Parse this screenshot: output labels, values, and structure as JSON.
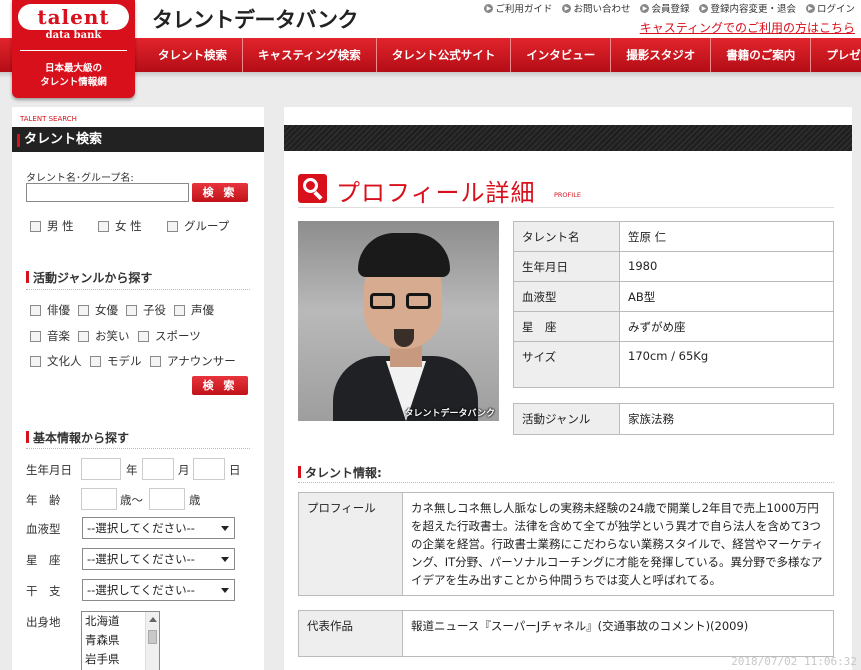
{
  "logo": {
    "word": "talent",
    "sub": "data bank",
    "tagline1": "日本最大級の",
    "tagline2": "タレント情報網"
  },
  "site_name": "タレントデータバンク",
  "top_links": [
    "ご利用ガイド",
    "お問い合わせ",
    "会員登録",
    "登録内容変更・退会",
    "ログイン"
  ],
  "casting_link": "キャスティングでのご利用の方はこちら",
  "nav": [
    "タレント検索",
    "キャスティング検索",
    "タレント公式サイト",
    "インタビュー",
    "撮影スタジオ",
    "書籍のご案内",
    "プレゼント"
  ],
  "sidebar": {
    "caption": "TALENT SEARCH",
    "title": "タレント検索",
    "name_label": "タレント名･グループ名:",
    "search_button": "検 索",
    "gender": [
      "男 性",
      "女 性",
      "グループ"
    ],
    "genre_title": "活動ジャンルから探す",
    "genres": [
      "俳優",
      "女優",
      "子役",
      "声優",
      "音楽",
      "お笑い",
      "スポーツ",
      "文化人",
      "モデル",
      "アナウンサー"
    ],
    "search_button2": "検 索",
    "basic_title": "基本情報から探す",
    "birth_label": "生年月日",
    "year": "年",
    "month": "月",
    "day": "日",
    "age_label": "年　齢",
    "age_from": "歳～",
    "age_to": "歳",
    "blood_label": "血液型",
    "sign_label": "星　座",
    "eto_label": "干　支",
    "select_placeholder": "--選択してください--",
    "origin_label": "出身地",
    "origins": [
      "北海道",
      "青森県",
      "岩手県"
    ]
  },
  "main": {
    "title": "プロフィール詳細",
    "title_sub": "PROFILE",
    "photo_watermark": "タレントデータバンク",
    "profile_rows": [
      {
        "key": "タレント名",
        "value": "笠原 仁"
      },
      {
        "key": "生年月日",
        "value": "1980"
      },
      {
        "key": "血液型",
        "value": "AB型"
      },
      {
        "key": "星　座",
        "value": "みずがめ座"
      },
      {
        "key": "サイズ",
        "value": "170cm / 65Kg"
      }
    ],
    "genre_key": "活動ジャンル",
    "genre_value": "家族法務",
    "info_title": "タレント情報:",
    "profile_key": "プロフィール",
    "profile_text": "カネ無しコネ無し人脈なしの実務未経験の24歳で開業し2年目で売上1000万円を超えた行政書士。法律を含めて全てが独学という異才で自ら法人を含めて3つの企業を経営。行政書士業務にこだわらない業務スタイルで、経営やマーケティング、IT分野、パーソナルコーチングに才能を発揮している。異分野で多様なアイデアを生み出すことから仲間うちでは変人と呼ばれてる。",
    "works_key": "代表作品",
    "works_text": "報道ニュース『スーパーJチャネル』(交通事故のコメント)(2009)"
  },
  "timestamp": "2018/07/02 11:06:32"
}
